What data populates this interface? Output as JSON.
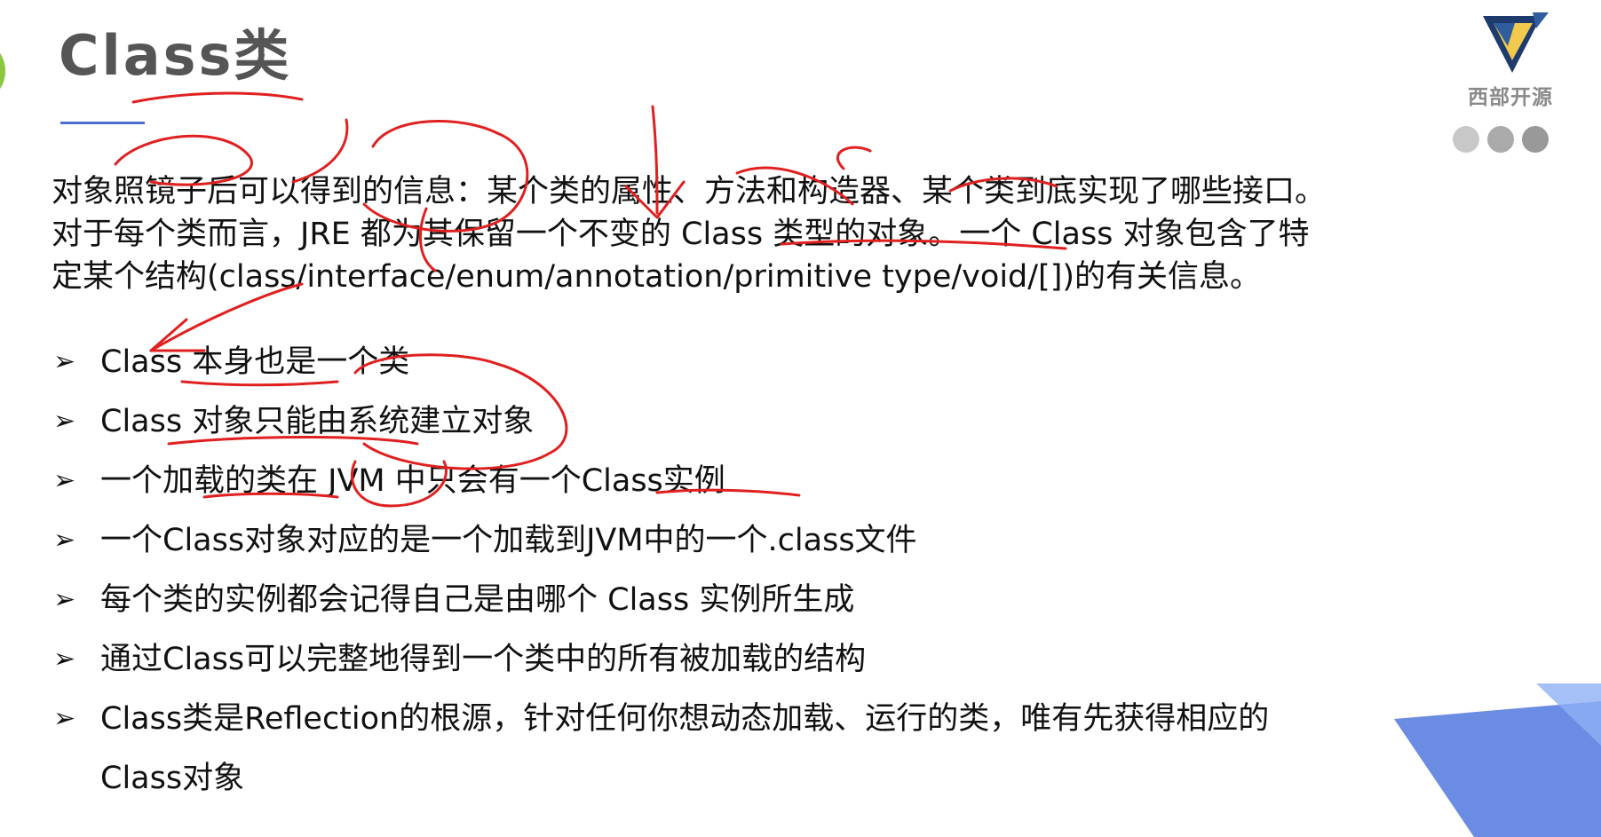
{
  "slide": {
    "title": "Class类",
    "logo": {
      "name": "西部开源",
      "icon": "triangle-logo-icon",
      "colors": [
        "#2f5d9f",
        "#f2c94c",
        "#1f3b6e"
      ]
    },
    "nav_dots_count": 3,
    "paragraph_lines": [
      "对象照镜子后可以得到的信息：某个类的属性、方法和构造器、某个类到底实现了哪些接口。",
      "对于每个类而言，JRE 都为其保留一个不变的 Class 类型的对象。一个 Class 对象包含了特",
      "定某个结构(class/interface/enum/annotation/primitive type/void/[])的有关信息。"
    ],
    "bullet_marker": "➢",
    "bullets": [
      "Class 本身也是一个类",
      "Class 对象只能由系统建立对象",
      "一个加载的类在 JVM 中只会有一个Class实例",
      "一个Class对象对应的是一个加载到JVM中的一个.class文件",
      "每个类的实例都会记得自己是由哪个 Class 实例所生成",
      "通过Class可以完整地得到一个类中的所有被加载的结构",
      "Class类是Reflection的根源，针对任何你想动态加载、运行的类，唯有先获得相应的"
    ],
    "bullet_continuation": "Class对象",
    "accent_colors": {
      "title_underline": "#4a6fd0",
      "annotation_ink": "#e02020",
      "corner_blue": "#5b7fe0",
      "left_circle": "#8dc63f"
    }
  }
}
